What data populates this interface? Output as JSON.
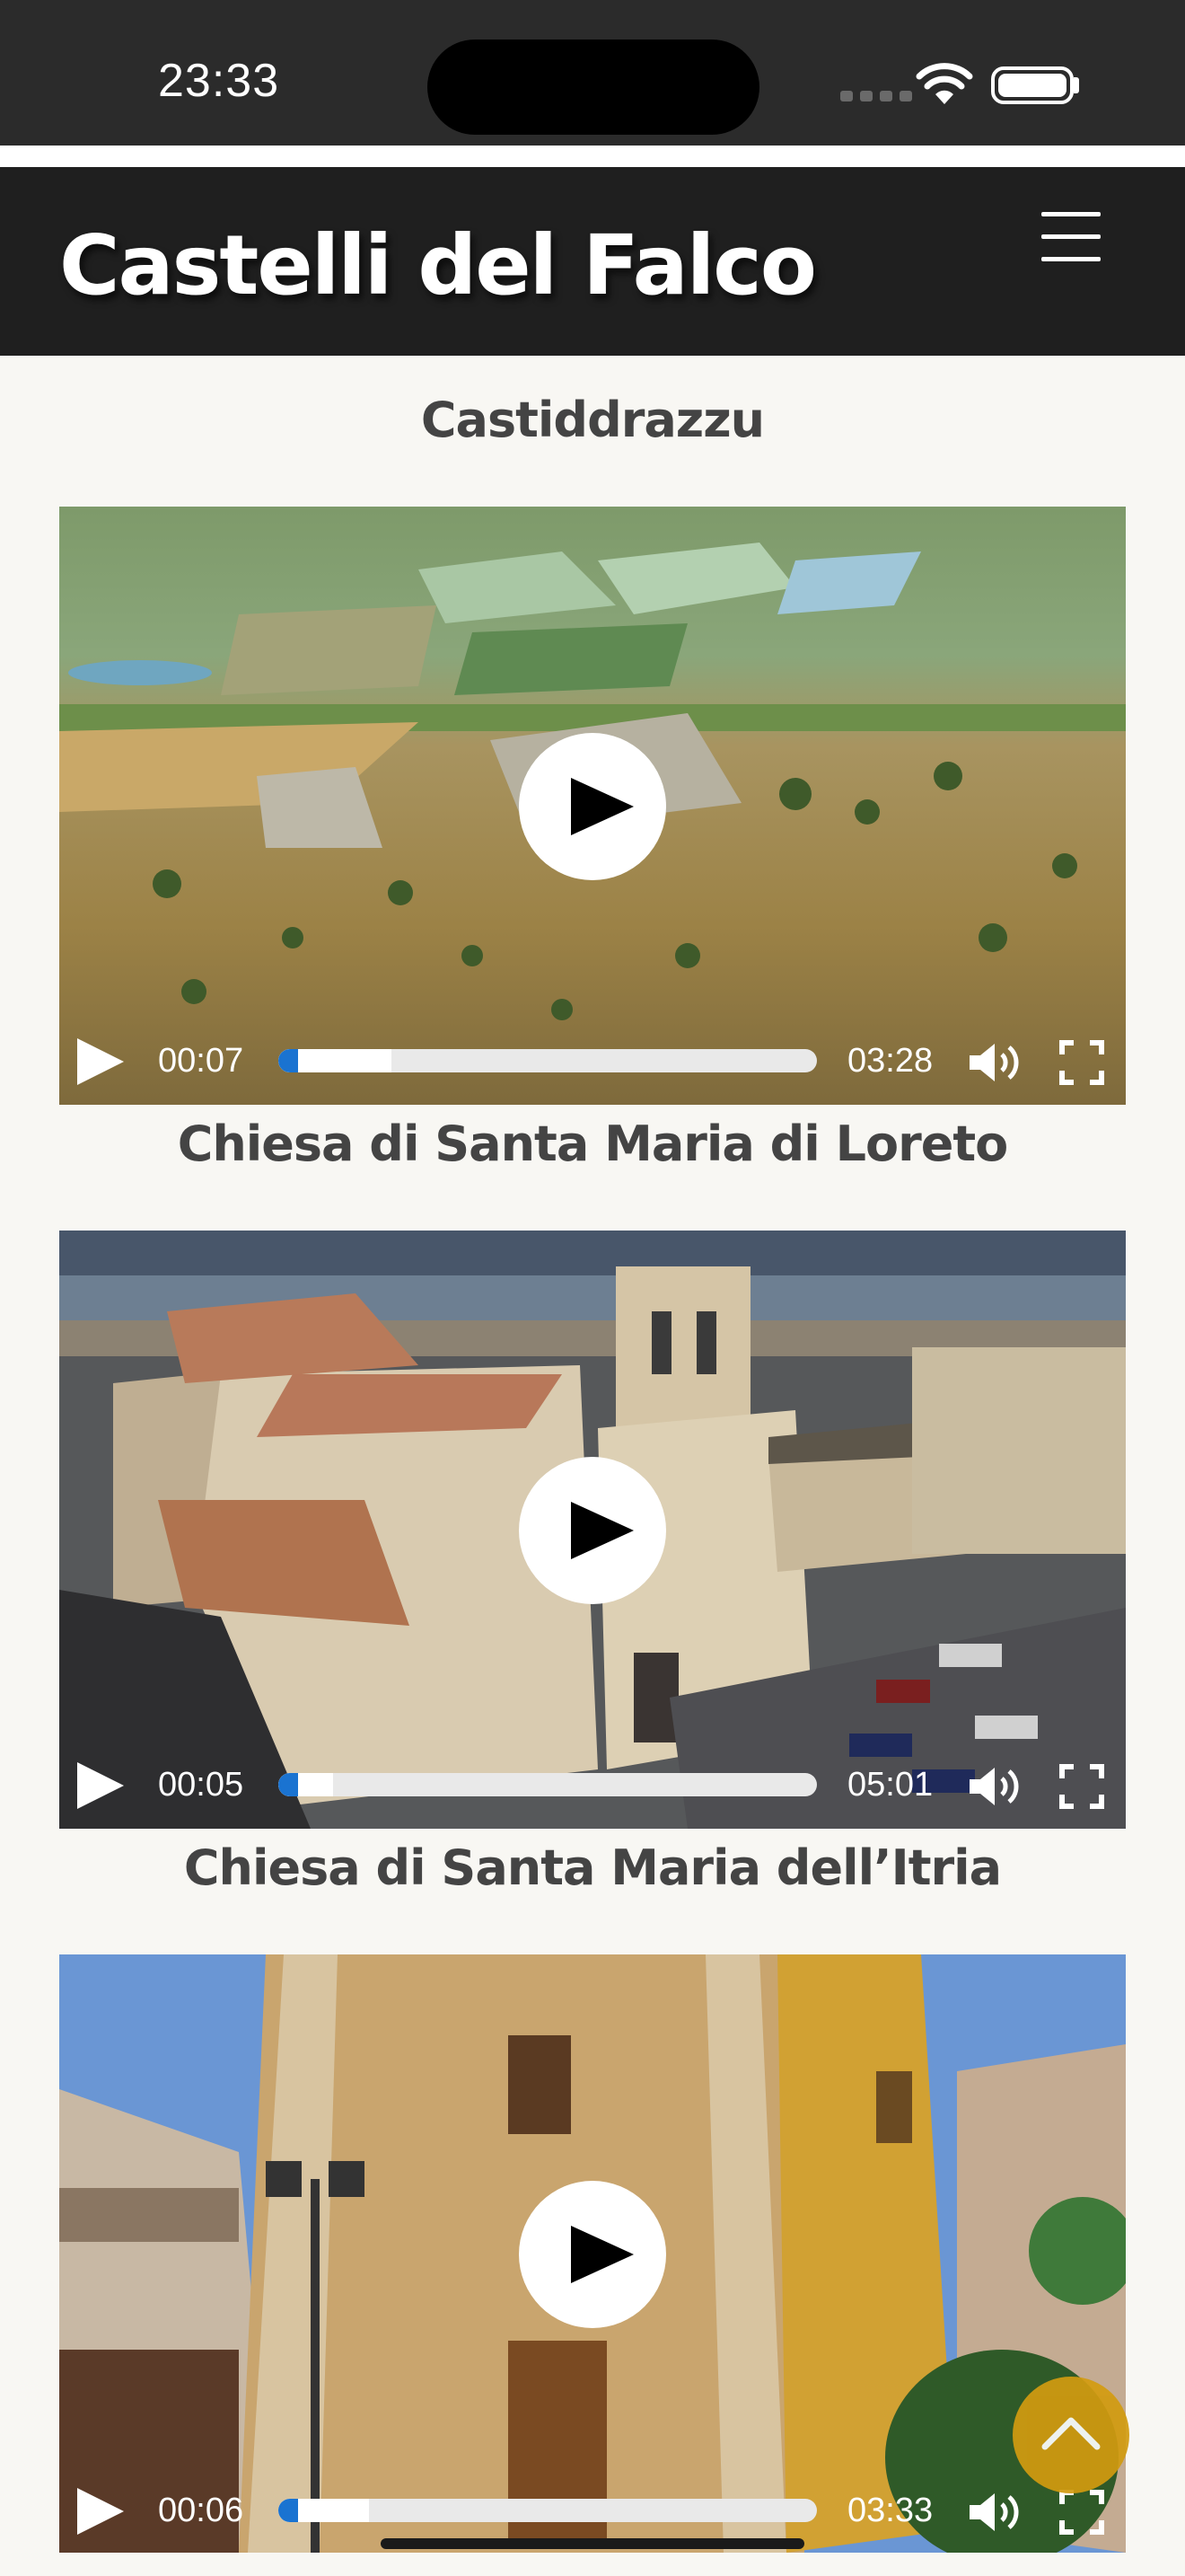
{
  "status_bar": {
    "time": "23:33"
  },
  "header": {
    "brand": "Castelli del Falco"
  },
  "sections": [
    {
      "title": "Castiddrazzu",
      "video": {
        "current": "00:07",
        "duration": "03:28",
        "progress": 0.035
      }
    },
    {
      "title": "Chiesa di Santa Maria di Loreto",
      "video": {
        "current": "00:05",
        "duration": "05:01",
        "progress": 0.017
      }
    },
    {
      "title": "Chiesa di Santa Maria dell’Itria",
      "video": {
        "current": "00:06",
        "duration": "03:33",
        "progress": 0.028
      }
    }
  ],
  "icons": {
    "menu": "hamburger-icon",
    "play": "play-icon",
    "volume": "volume-icon",
    "fullscreen": "fullscreen-icon",
    "scroll_top": "chevron-up-icon"
  },
  "colors": {
    "header_bg": "#1f1f1f",
    "page_bg": "#f8f7f3",
    "accent": "#d29b10",
    "progress": "#1a73d1"
  }
}
